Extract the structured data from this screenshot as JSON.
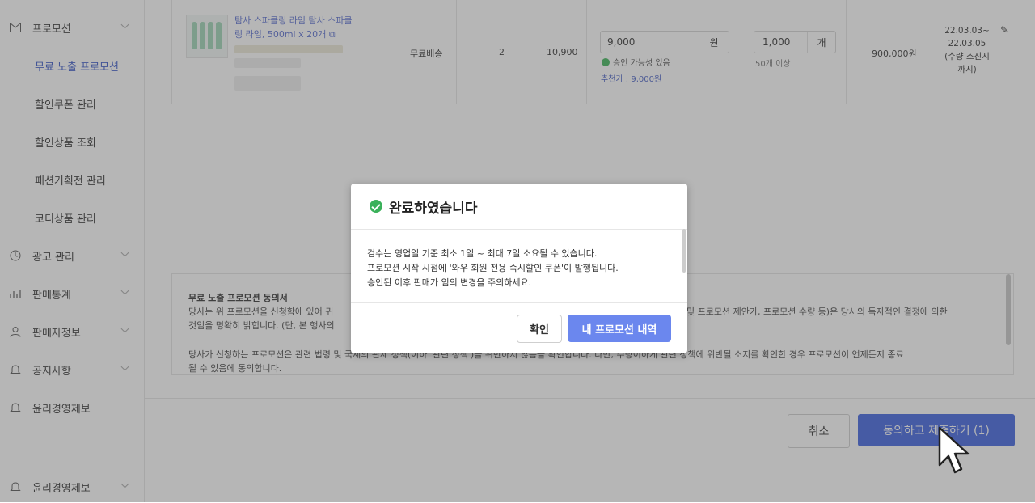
{
  "sidebar": {
    "items": [
      {
        "label": "프로모션"
      },
      {
        "label": "무료 노출 프로모션"
      },
      {
        "label": "할인쿠폰 관리"
      },
      {
        "label": "할인상품 조회"
      },
      {
        "label": "패션기획전 관리"
      },
      {
        "label": "코디상품 관리"
      },
      {
        "label": "광고 관리"
      },
      {
        "label": "판매통계"
      },
      {
        "label": "판매자정보"
      },
      {
        "label": "공지사항"
      },
      {
        "label": "윤리경영제보"
      },
      {
        "label": "윤리경영제보"
      }
    ]
  },
  "product": {
    "name_line1": "탐사 스파클링 라임 탐사 스파클",
    "name_line2": "링 라임, 500ml x 20개",
    "delivery": "무료배송",
    "stock": "2",
    "price": "10,900",
    "promo_price": "9,000",
    "promo_price_unit": "원",
    "approval_note": "승인 가능성 있음",
    "recommended": "추천가 : 9,000원",
    "qty": "1,000",
    "qty_unit": "개",
    "min_qty": "50개 이상",
    "total": "900,000원",
    "period_line1": "22.03.03~",
    "period_line2": "22.03.05",
    "period_line3": "(수량 소진시",
    "period_line4": "까지)"
  },
  "agreement": {
    "title": "무료 노출 프로모션 동의서",
    "line1_left": "당사는 위 프로모션을 신청함에 있어 귀",
    "line1_right": "및 프로모션 제안가, 프로모션 수량 등)은 당사의 독자적인 결정에 의한",
    "line2": "것임을 명확히 밝힙니다. (단, 본 행사의",
    "line3_left": "당사가 신청하는 프로모션은 관련 법령 및 국제의 관세 정책(이하 '관련 정책')을 위반하지 않음을 확인합니다. 다만, 수량이하게 관련 정책에 위반될 소지를 확인한 경우 프로모션이 언제든지 종료",
    "line4": "될 수 있음에 동의합니다."
  },
  "bottom": {
    "cancel_label": "취소",
    "submit_label": "동의하고 제출하기 (1)"
  },
  "modal": {
    "title": "완료하였습니다",
    "line1": "검수는 영업일 기준 최소 1일 ~ 최대 7일 소요될 수 있습니다.",
    "line2": "프로모션 시작 시점에 '와우 회원 전용 즉시할인 쿠폰'이 발행됩니다.",
    "line3": "승인된 이후 판매가 임의 변경을 주의하세요.",
    "confirm_label": "확인",
    "my_promo_label": "내 프로모션 내역"
  },
  "colors": {
    "accent": "#3f63e0",
    "modal_primary": "#6b87ee",
    "success": "#3ab15a",
    "active_menu": "#3a58c9"
  }
}
